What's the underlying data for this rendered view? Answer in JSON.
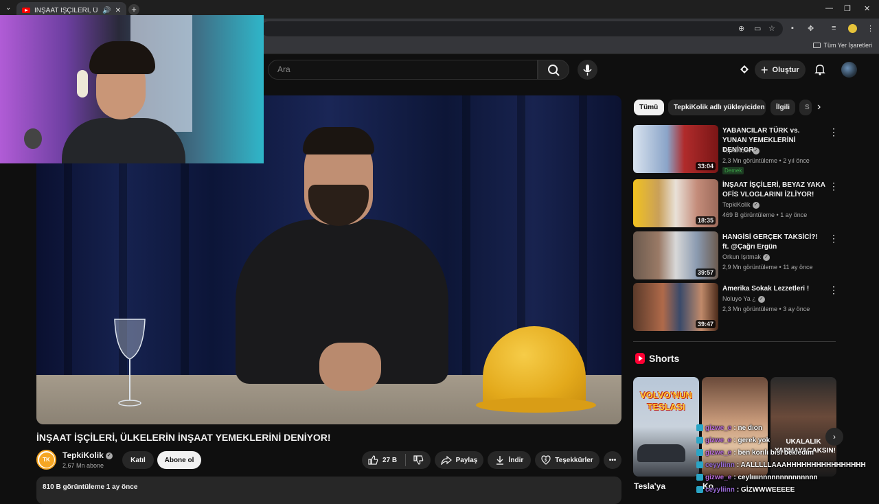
{
  "browser": {
    "tab_title": "İNŞAAT İŞÇİLERİ, ÜLKELERİN",
    "new_tab": "+",
    "bookmarks_all": "Tüm Yer İşaretleri"
  },
  "header": {
    "search_placeholder": "Ara",
    "create_label": "Oluştur"
  },
  "video": {
    "title": "İNŞAAT İŞÇİLERİ, ÜLKELERİN İNŞAAT YEMEKLERİNİ DENİYOR!",
    "channel": "TepkiKolik",
    "channel_initials": "TK",
    "subscribers": "2,67 Mn abone",
    "join_label": "Katıl",
    "subscribe_label": "Abone ol",
    "likes": "27 B",
    "share_label": "Paylaş",
    "download_label": "İndir",
    "thanks_label": "Teşekkürler",
    "description_meta": "810 B görüntüleme  1 ay önce"
  },
  "chips": [
    {
      "label": "Tümü"
    },
    {
      "label": "TepkiKolik adlı yükleyiciden"
    },
    {
      "label": "İlgili"
    },
    {
      "label": "S"
    }
  ],
  "recommended": [
    {
      "title": "YABANCILAR TÜRK vs. YUNAN YEMEKLERİNİ DENİYOR!",
      "channel": "TepkiKolik",
      "meta": "2,3 Mn görüntüleme • 2 yıl önce",
      "duration": "33:04",
      "badge": "Demek"
    },
    {
      "title": "İNŞAAT İŞÇİLERİ, BEYAZ YAKA OFİS VLOGLARINI İZLİYOR!",
      "channel": "TepkiKolik",
      "meta": "469 B görüntüleme • 1 ay önce",
      "duration": "18:35"
    },
    {
      "title": "HANGİSİ GERÇEK TAKSİCİ?! ft. @Çağrı Ergün",
      "channel": "Orkun Işıtmak",
      "meta": "2,9 Mn görüntüleme • 11 ay önce",
      "duration": "39:57"
    },
    {
      "title": "Amerika Sokak Lezzetleri !",
      "channel": "Noluyo Ya ¿",
      "meta": "2,3 Mn görüntüleme • 3 ay önce",
      "duration": "39:47"
    }
  ],
  "shorts": {
    "title": "Shorts",
    "items": [
      {
        "caption": "Tesla'ya",
        "overlay": "VOLVO'NUN TESLASI"
      },
      {
        "caption": "Ko",
        "overlay": ""
      },
      {
        "caption": "",
        "overlay": "UKALALIK YAPMAYACAKSIN!"
      }
    ]
  },
  "chat": [
    {
      "user": "gizwe_e",
      "text": " : ne dıon",
      "color": "#b86bd8"
    },
    {
      "user": "gizwe_e",
      "text": " : gerek yok",
      "color": "#b86bd8"
    },
    {
      "user": "gizwe_e",
      "text": " : ben korılı bısı bekledım",
      "color": "#b86bd8"
    },
    {
      "user": "ceyyliinn",
      "text": " : AALLLLLAAAHHHHHHHHHHHHHHHH",
      "color": "#9a6bd8"
    },
    {
      "user": "gizwe_e",
      "text": " : ceylıııınnnnnnnnnnnnnn",
      "color": "#b86bd8"
    },
    {
      "user": "ceyyliinn",
      "text": " : GİZWWWEEEEE",
      "color": "#9a6bd8"
    }
  ]
}
